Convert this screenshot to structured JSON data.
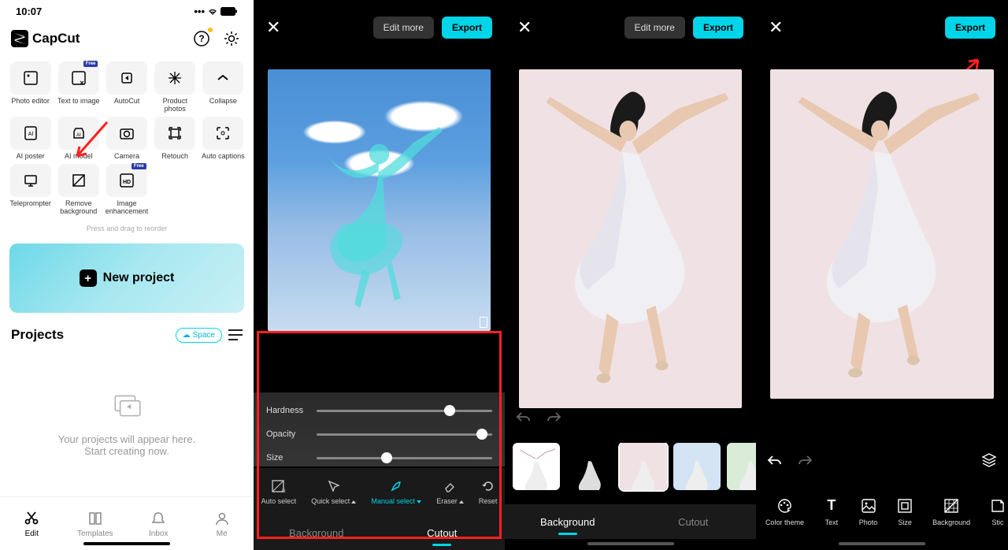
{
  "status": {
    "time": "10:07"
  },
  "app": {
    "name": "CapCut"
  },
  "tools": [
    {
      "label": "Photo editor",
      "badge": ""
    },
    {
      "label": "Text to image",
      "badge": "Free"
    },
    {
      "label": "AutoCut",
      "badge": ""
    },
    {
      "label": "Product photos",
      "badge": ""
    },
    {
      "label": "Collapse",
      "badge": ""
    },
    {
      "label": "AI poster",
      "badge": ""
    },
    {
      "label": "AI model",
      "badge": ""
    },
    {
      "label": "Camera",
      "badge": ""
    },
    {
      "label": "Retouch",
      "badge": ""
    },
    {
      "label": "Auto captions",
      "badge": ""
    },
    {
      "label": "Teleprompter",
      "badge": ""
    },
    {
      "label": "Remove background",
      "badge": ""
    },
    {
      "label": "Image enhancement",
      "badge": "Free"
    }
  ],
  "reorder_hint": "Press and drag to reorder",
  "new_project": "New project",
  "projects": {
    "title": "Projects",
    "space": "Space",
    "empty1": "Your projects will appear here.",
    "empty2": "Start creating now."
  },
  "nav": [
    {
      "label": "Edit"
    },
    {
      "label": "Templates"
    },
    {
      "label": "Inbox"
    },
    {
      "label": "Me"
    }
  ],
  "editor": {
    "edit_more": "Edit more",
    "export": "Export"
  },
  "sliders": [
    {
      "label": "Hardness",
      "pct": 76
    },
    {
      "label": "Opacity",
      "pct": 94
    },
    {
      "label": "Size",
      "pct": 40
    }
  ],
  "cutout_tools": [
    {
      "label": "Auto select"
    },
    {
      "label": "Quick select",
      "arrow": "up"
    },
    {
      "label": "Manual select",
      "arrow": "down",
      "active": true
    },
    {
      "label": "Eraser",
      "arrow": "up"
    },
    {
      "label": "Reset"
    }
  ],
  "tabs2": {
    "a": "Background",
    "b": "Cutout"
  },
  "tabs3": {
    "a": "Background",
    "b": "Cutout"
  },
  "p4_tools": [
    {
      "label": "Color theme"
    },
    {
      "label": "Text"
    },
    {
      "label": "Photo"
    },
    {
      "label": "Size"
    },
    {
      "label": "Background"
    },
    {
      "label": "Stic"
    }
  ]
}
